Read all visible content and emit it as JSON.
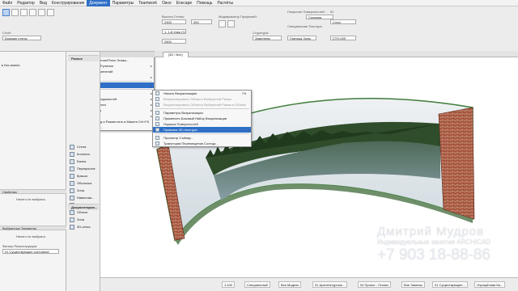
{
  "menubar": {
    "items": [
      "Файл",
      "Редактор",
      "Вид",
      "Конструирование",
      "Документ",
      "Параметры",
      "Teamwork",
      "Окно",
      "Enscape",
      "Помощь",
      "Расчёты"
    ],
    "active_index": 4
  },
  "ribbon": {
    "sloy_label": "Слой:",
    "sloy_value": "Бывшие стены",
    "height_label": "Высота Стены:",
    "height_value": "2300",
    "prof_label": "Модификатор Профилей:",
    "structure_label": "Структура:",
    "structure_value": "Заменены",
    "surface_label": "Покрытие Поверхностей:",
    "surface_value": "Средина",
    "linetype_label": "Специальная Текстура",
    "zone_label": "Граница Зоны",
    "id_label": "ID:",
    "id_value": "СТН-009",
    "id_top": "Слои",
    "floor_value": "1. 1-й этаж (Собств.)",
    "thickness_value": "2800",
    "offset_value": "300"
  },
  "tabbar": {
    "tab_label": "[3D / Все]"
  },
  "left_panel": {
    "tree_root": "Без имени",
    "properties_header": "Свойства",
    "nothing_selected": "Ничего не выбрано.",
    "selected_header": "Выбранные Элементы",
    "nothing_selected_2": "Ничего не выбрано.",
    "renovation_filter_label": "Фильтр Реконструкции:",
    "renovation_filter_value": "01 Существующее состояние"
  },
  "toolbox": {
    "items": [
      "Стена",
      "Колонна",
      "Балка",
      "Перекрытие",
      "Крыша",
      "Оболочка",
      "Зона",
      "Навесная...",
      "Морф",
      "Объект",
      "Зона",
      "3D-сетка"
    ],
    "group_document": "Документиров...",
    "group_more": "Разное"
  },
  "document_menu": {
    "items": [
      {
        "label": "Инструменты Документирования",
        "arrow": true
      },
      {
        "label": "Слои",
        "arrow": true
      },
      {
        "sep": true
      },
      {
        "label": "3D-манипуля...",
        "arrow": false
      },
      {
        "label": "Непосильная Позиц Конструкций...",
        "arrow": false
      },
      {
        "label": "Наборы Перьев",
        "arrow": true
      },
      {
        "label": "Модельный Вид",
        "arrow": true
      },
      {
        "label": "Графическая Замена",
        "arrow": true
      },
      {
        "label": "Реконструкция",
        "arrow": true
      },
      {
        "sep": true
      },
      {
        "label": "Показать Сечение/План Этажа...",
        "arrow": false
      },
      {
        "label": "Инструменты Руления",
        "arrow": true
      },
      {
        "label": "Менеджер Изменений",
        "arrow": false
      },
      {
        "label": "Аннотация",
        "arrow": true
      },
      {
        "sep": true
      },
      {
        "label": "Визуализация",
        "arrow": true,
        "highlight": true
      },
      {
        "sep": true
      },
      {
        "label": "Каталоги",
        "arrow": true
      },
      {
        "label": "Дополнение Ведомостей",
        "arrow": true
      },
      {
        "label": "Индексы Проекта",
        "arrow": true
      },
      {
        "label": "Книга Макетов",
        "arrow": true
      },
      {
        "label": "Чертежи",
        "arrow": true
      },
      {
        "label": "Сохранить Вид и Разместить в Макете",
        "shortcut": "Ctrl+F8"
      },
      {
        "label": "Опубликовать...",
        "arrow": false
      }
    ]
  },
  "visual_submenu": {
    "items": [
      {
        "label": "Начать Визуализацию",
        "shortcut": "F6"
      },
      {
        "label": "Визуализировать Область Выбранной Рамки",
        "disabled": true
      },
      {
        "label": "Визуализировать Область Выбранной Рамки в Облаке",
        "disabled": true
      },
      {
        "sep": true
      },
      {
        "label": "Параметры Визуализации"
      },
      {
        "label": "Применить Базовый Набор Визуализации"
      },
      {
        "label": "Окраска Поверхностей"
      },
      {
        "label": "Привязка 3D-текстуры",
        "arrow": true,
        "highlight": true
      },
      {
        "sep": true
      },
      {
        "label": "Просмотр Съёмку..."
      },
      {
        "label": "Траектория Перемещения Солнца..."
      }
    ]
  },
  "watermark": {
    "name": "Дмитрий Мудров",
    "subtitle": "Индивидуальные занятия ARCHICAD",
    "phone": "+7 903 18-88-86"
  },
  "statusbar": {
    "zoom": "1:100",
    "scale": "Специальный",
    "item1": "Вся Модель",
    "item2": "01 Архитектурные...",
    "item3": "04 Проект - Планы",
    "item4": "Вне Замены",
    "item5": "01 Существующее...",
    "item6": "Упрощённая Кв..."
  },
  "colors": {
    "accent": "#2f6fc7",
    "frame_green": "#3f7d3a",
    "brick": "#9c4a35"
  }
}
